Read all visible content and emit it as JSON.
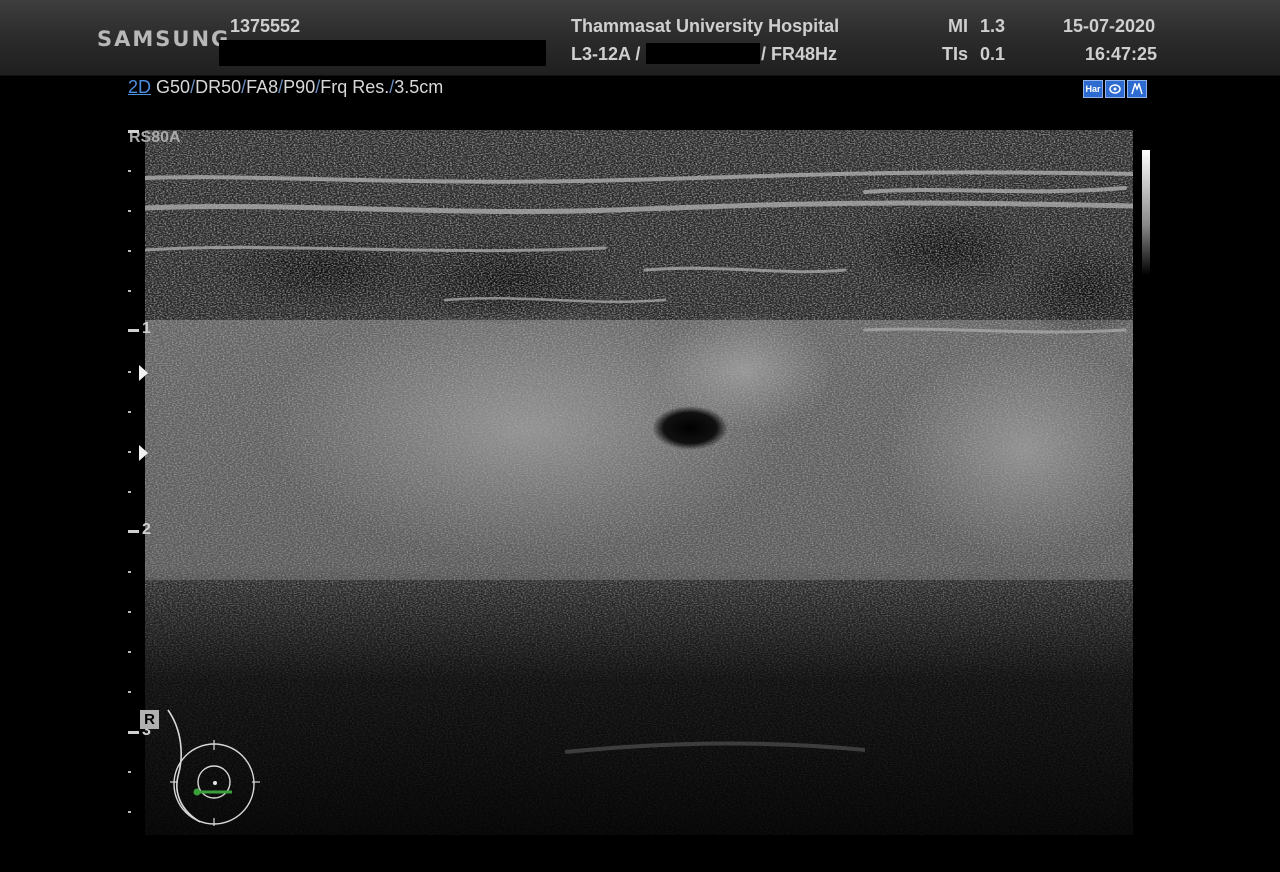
{
  "header": {
    "logo": "SAMSUNG",
    "patient_id": "1375552",
    "hospital": "Thammasat University Hospital",
    "probe": "L3-12A /",
    "frame_rate": "/ FR48Hz",
    "mi_label": "MI",
    "mi_value": "1.3",
    "tis_label": "TIs",
    "tis_value": "0.1",
    "date": "15-07-2020",
    "time": "16:47:25"
  },
  "mode": {
    "mode_2d": "2D",
    "gain": "G50",
    "dynamic_range": "DR50",
    "frame_avg": "FA8",
    "power": "P90",
    "frequency": "Frq Res.",
    "depth": "3.5cm",
    "separator": "/"
  },
  "status_icons": [
    {
      "label": "Har",
      "icon": "harmonic-icon"
    },
    {
      "label": "",
      "icon": "probe-icon"
    },
    {
      "label": "",
      "icon": "s-vue-icon"
    }
  ],
  "image": {
    "preset_name": "RS80A"
  },
  "depth_scale": {
    "labels": [
      "1",
      "2",
      "3"
    ]
  },
  "body_marker": {
    "orientation": "R"
  },
  "colors": {
    "accent_blue": "#4a8fe0",
    "icon_blue": "#2e6bd0",
    "probe_marker_green": "#3aa03a",
    "header_gray": "#2f2f2f"
  }
}
